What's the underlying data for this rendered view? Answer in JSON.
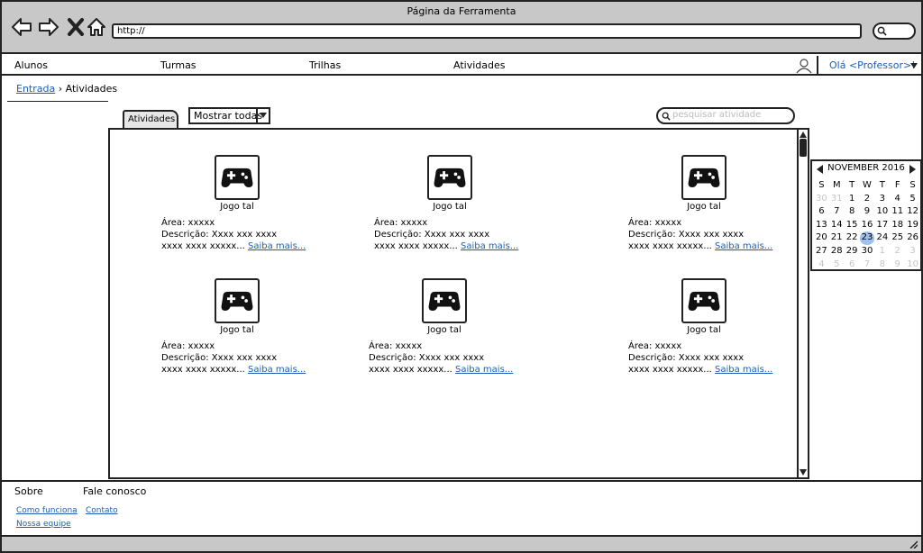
{
  "window": {
    "title": "Página da Ferramenta"
  },
  "browser": {
    "url": "http://",
    "icons": [
      "back-arrow-icon",
      "forward-arrow-icon",
      "close-x-icon",
      "home-icon"
    ]
  },
  "menu": {
    "items": [
      "Alunos",
      "Turmas",
      "Trilhas",
      "Atividades"
    ],
    "user_label": "Olá <Professor>!",
    "user_icon": "user-icon"
  },
  "breadcrumb": {
    "link": "Entrada",
    "separator": "›",
    "current": "Atividades"
  },
  "toolbar": {
    "tab_label": "Atividades",
    "filter_value": "Mostrar todas",
    "search_placeholder": "pesquisar atividade"
  },
  "activities": [
    {
      "name": "Jogo tal",
      "area": "Área: xxxxx",
      "desc": "Descrição: Xxxx xxx xxxx",
      "desc2": "xxxx xxxx xxxxx...",
      "link": "Saiba mais..."
    },
    {
      "name": "Jogo tal",
      "area": "Área: xxxxx",
      "desc": "Descrição: Xxxx xxx xxxx",
      "desc2": "xxxx xxxx xxxxx...",
      "link": "Saiba mais..."
    },
    {
      "name": "Jogo tal",
      "area": "Área: xxxxx",
      "desc": "Descrição: Xxxx xxx xxxx",
      "desc2": "xxxx xxxx xxxxx...",
      "link": "Saiba mais..."
    },
    {
      "name": "Jogo tal",
      "area": "Área: xxxxx",
      "desc": "Descrição: Xxxx xxx xxxx",
      "desc2": "xxxx xxxx xxxxx...",
      "link": "Saiba mais..."
    },
    {
      "name": "Jogo tal",
      "area": "Área: xxxxx",
      "desc": "Descrição: Xxxx xxx xxxx",
      "desc2": "xxxx xxxx xxxxx...",
      "link": "Saiba mais..."
    },
    {
      "name": "Jogo tal",
      "area": "Área: xxxxx",
      "desc": "Descrição: Xxxx xxx xxxx",
      "desc2": "xxxx xxxx xxxxx...",
      "link": "Saiba mais..."
    }
  ],
  "calendar": {
    "month_label": "NOVEMBER 2016",
    "weekdays": [
      "S",
      "M",
      "T",
      "W",
      "T",
      "F",
      "S"
    ],
    "days": [
      {
        "d": "30",
        "muted": true
      },
      {
        "d": "31",
        "muted": true
      },
      {
        "d": "1"
      },
      {
        "d": "2"
      },
      {
        "d": "3"
      },
      {
        "d": "4"
      },
      {
        "d": "5"
      },
      {
        "d": "6"
      },
      {
        "d": "7"
      },
      {
        "d": "8"
      },
      {
        "d": "9"
      },
      {
        "d": "10"
      },
      {
        "d": "11"
      },
      {
        "d": "12"
      },
      {
        "d": "13"
      },
      {
        "d": "14"
      },
      {
        "d": "15"
      },
      {
        "d": "16"
      },
      {
        "d": "17"
      },
      {
        "d": "18"
      },
      {
        "d": "19"
      },
      {
        "d": "20"
      },
      {
        "d": "21"
      },
      {
        "d": "22"
      },
      {
        "d": "23",
        "today": true
      },
      {
        "d": "24"
      },
      {
        "d": "25"
      },
      {
        "d": "26"
      },
      {
        "d": "27"
      },
      {
        "d": "28"
      },
      {
        "d": "29"
      },
      {
        "d": "30"
      },
      {
        "d": "1",
        "muted": true
      },
      {
        "d": "2",
        "muted": true
      },
      {
        "d": "3",
        "muted": true
      },
      {
        "d": "4",
        "muted": true
      },
      {
        "d": "5",
        "muted": true
      },
      {
        "d": "6",
        "muted": true
      },
      {
        "d": "7",
        "muted": true
      },
      {
        "d": "8",
        "muted": true
      },
      {
        "d": "9",
        "muted": true
      },
      {
        "d": "10",
        "muted": true
      }
    ]
  },
  "footer": {
    "sobre": "Sobre",
    "fale": "Fale conosco",
    "como": "Como funciona",
    "contato": "Contato",
    "equipe": "Nossa equipe"
  },
  "colors": {
    "link": "#1a5fb4",
    "chrome": "#c8c8c8",
    "today_highlight": "#9ec2f0"
  }
}
